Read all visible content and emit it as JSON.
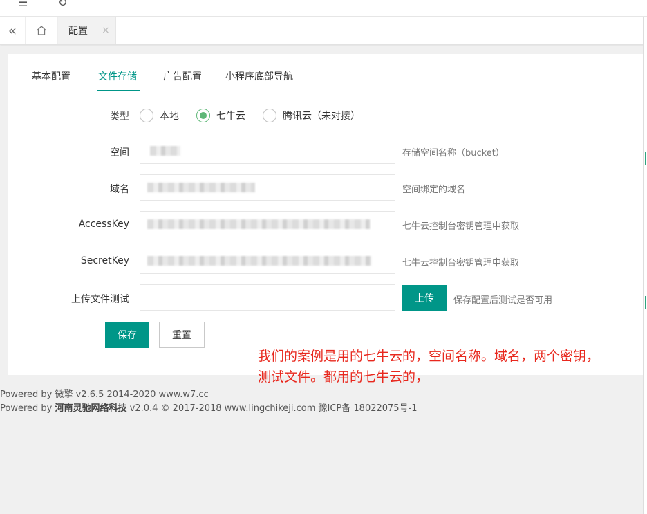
{
  "tabbar": {
    "back_icon": "double-chevron-left-icon",
    "home_icon": "home-icon",
    "tab_label": "配置",
    "close_symbol": "×"
  },
  "nav": {
    "items": [
      "基本配置",
      "文件存储",
      "广告配置",
      "小程序底部导航"
    ],
    "active": "文件存储"
  },
  "form": {
    "type_label": "类型",
    "options": [
      "本地",
      "七牛云",
      "腾讯云（未对接）"
    ],
    "selected": "七牛云",
    "space_label": "空间",
    "space_hint": "存储空间名称（bucket）",
    "domain_label": "域名",
    "domain_hint": "空间绑定的域名",
    "access_label": "AccessKey",
    "access_hint": "七牛云控制台密钥管理中获取",
    "secret_label": "SecretKey",
    "secret_hint": "七牛云控制台密钥管理中获取",
    "upload_label": "上传文件测试",
    "upload_button": "上传",
    "upload_hint": "保存配置后测试是否可用",
    "save_button": "保存",
    "reset_button": "重置"
  },
  "annotation": [
    "我们的案例是用的七牛云的，空间名称。域名，两个密钥，",
    "测试文件。都用的七牛云的，"
  ],
  "footer": {
    "line1": "Powered by 微擎 v2.6.5 2014-2020 www.w7.cc",
    "line2_prefix": "Powered by ",
    "line2_company": "河南灵驰网络科技",
    "line2_suffix": " v2.0.4 © 2017-2018 www.lingchikeji.com 豫ICP备 18022075号-1"
  },
  "colors": {
    "accent": "#009688",
    "radio": "#5fb878",
    "annotation": "#e8281e"
  }
}
